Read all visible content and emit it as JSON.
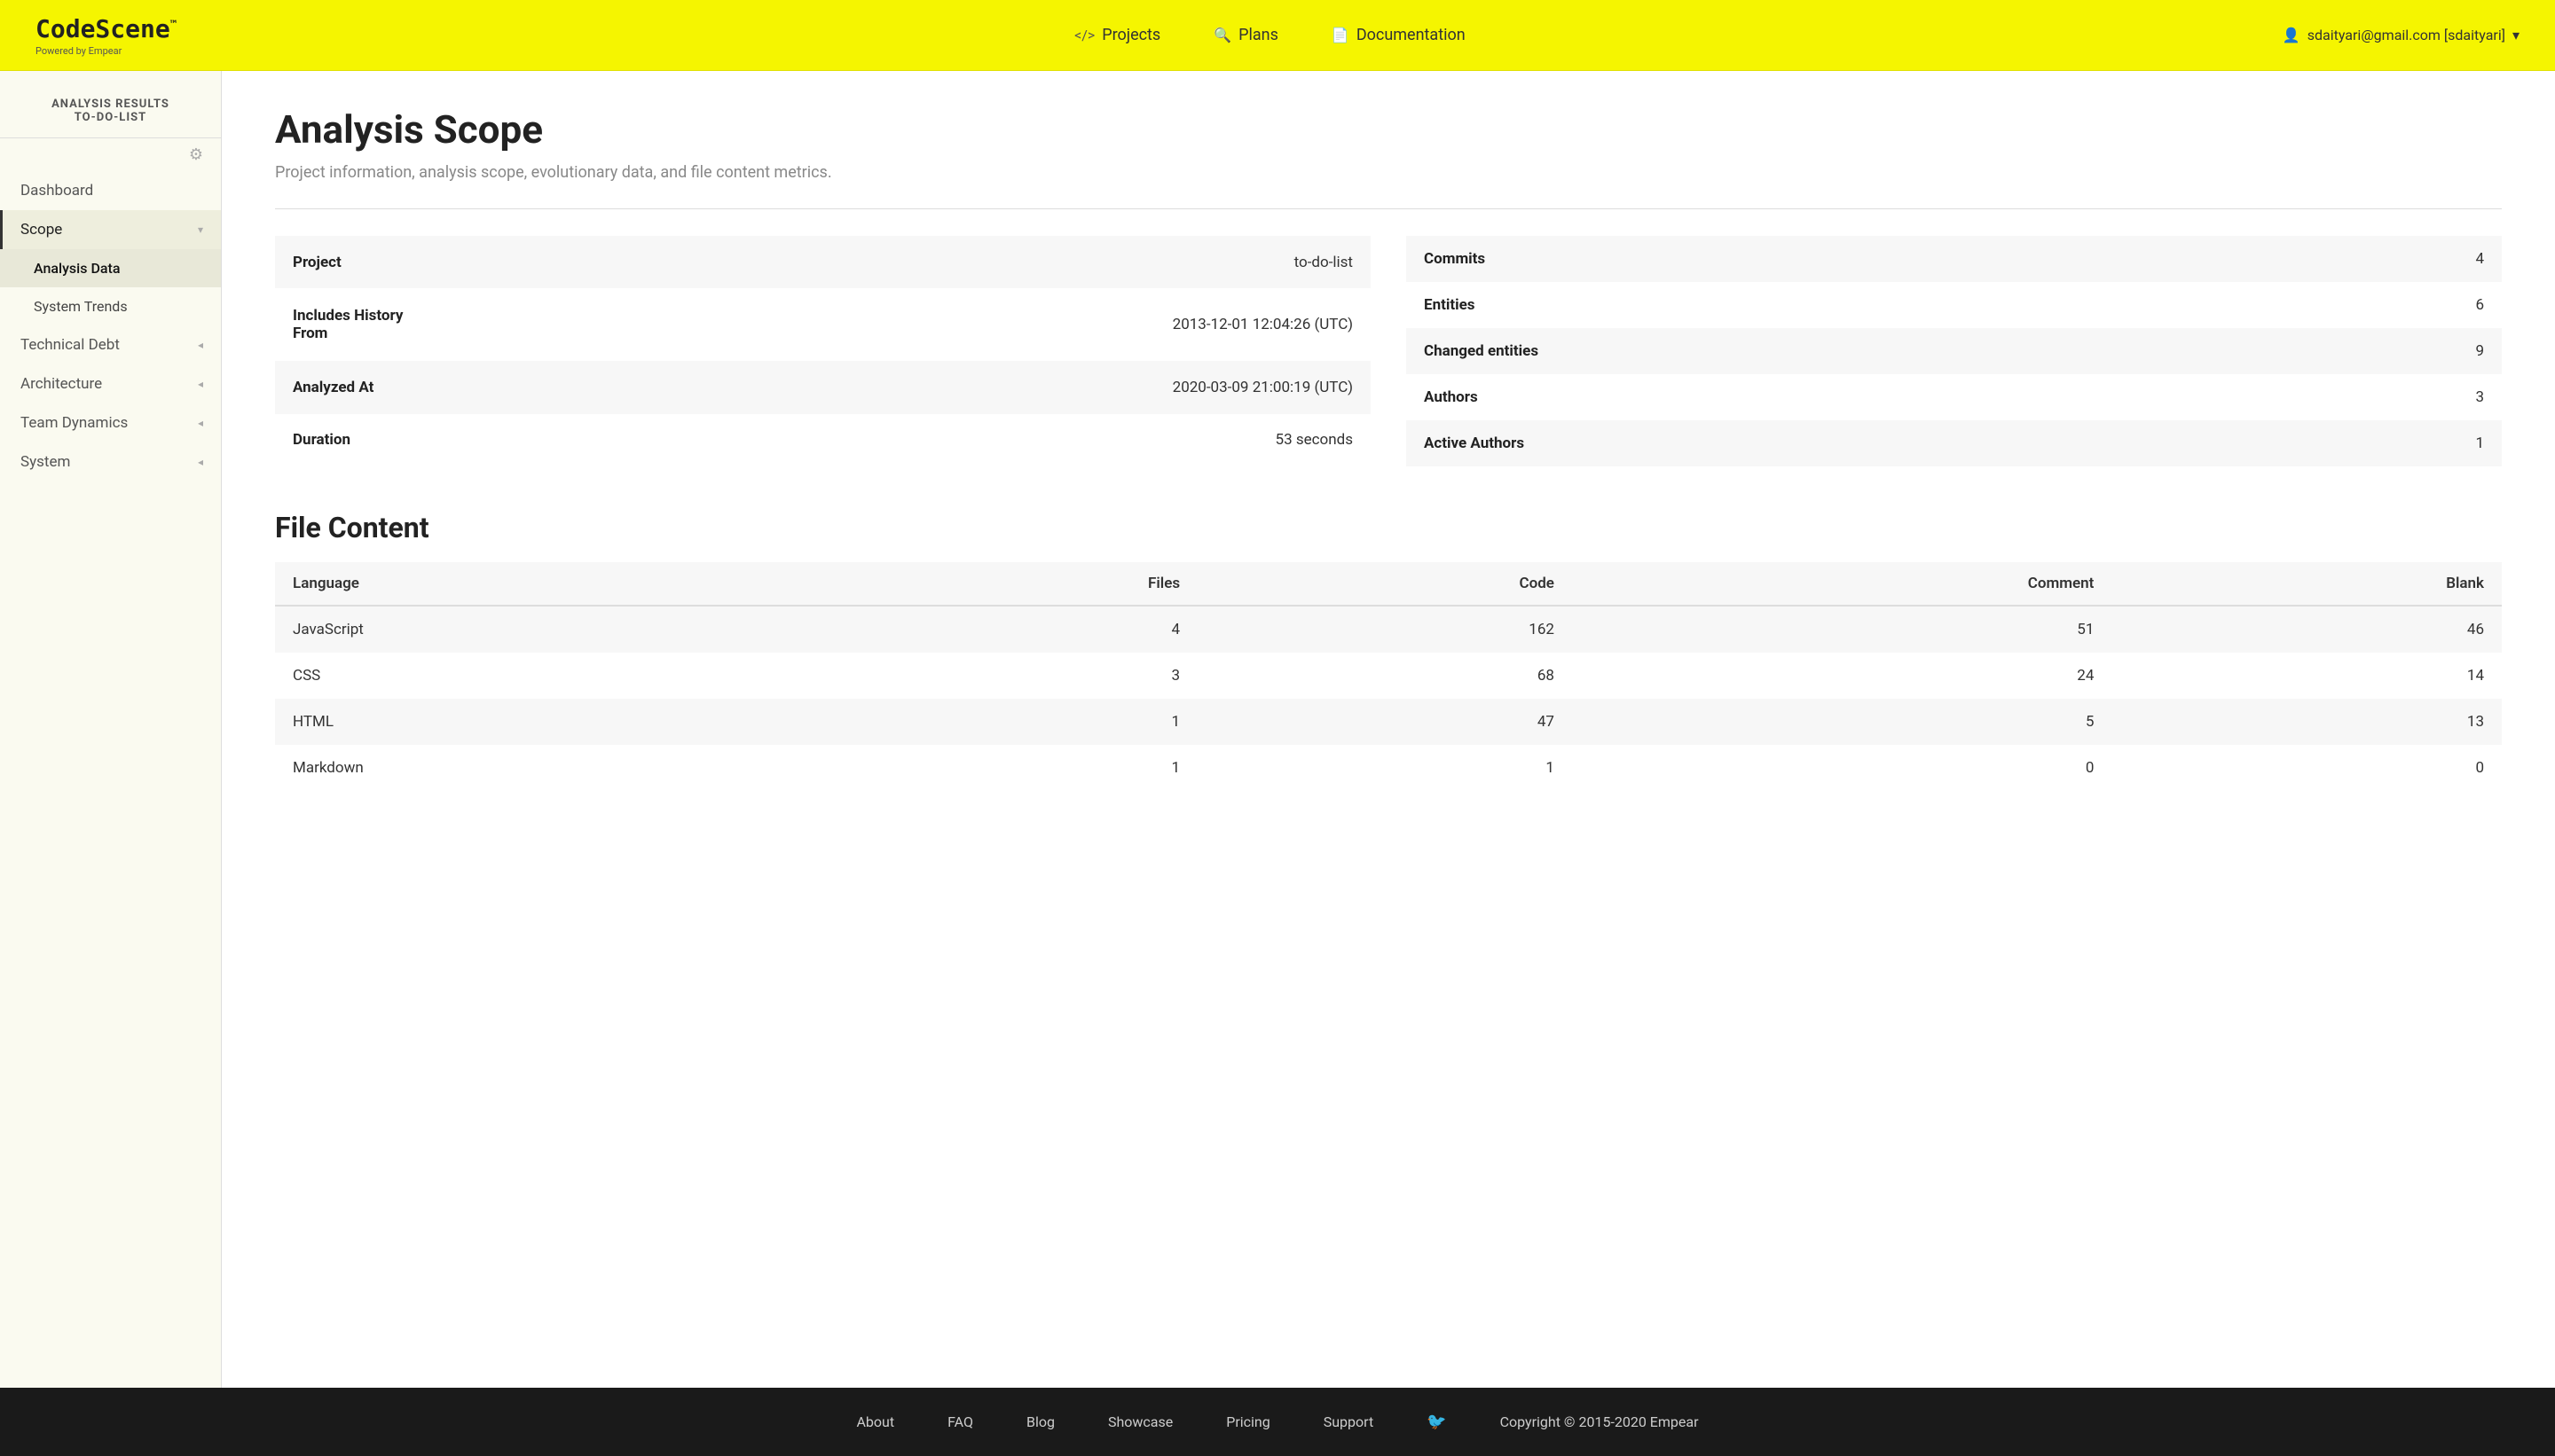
{
  "header": {
    "logo_title": "CodeScene",
    "logo_tm": "™",
    "logo_sub": "Powered by Empear",
    "nav": [
      {
        "label": "Projects",
        "icon": "</>"
      },
      {
        "label": "Plans",
        "icon": "🔍"
      },
      {
        "label": "Documentation",
        "icon": "📄"
      }
    ],
    "user": "sdaityari@gmail.com [sdaityari]",
    "user_icon": "👤"
  },
  "sidebar": {
    "title": "ANALYSIS RESULTS",
    "subtitle": "TO-DO-LIST",
    "items": [
      {
        "label": "Dashboard",
        "has_chevron": false,
        "active": false
      },
      {
        "label": "Scope",
        "has_chevron": true,
        "active": true
      },
      {
        "label": "Analysis Data",
        "is_sub": true,
        "active_sub": true
      },
      {
        "label": "System Trends",
        "is_sub": true,
        "active_sub": false
      },
      {
        "label": "Technical Debt",
        "has_chevron": true,
        "active": false
      },
      {
        "label": "Architecture",
        "has_chevron": true,
        "active": false
      },
      {
        "label": "Team Dynamics",
        "has_chevron": true,
        "active": false
      },
      {
        "label": "System",
        "has_chevron": true,
        "active": false
      }
    ]
  },
  "main": {
    "title": "Analysis Scope",
    "subtitle": "Project information, analysis scope, evolutionary data, and file content metrics.",
    "project_info": [
      {
        "label": "Project",
        "value": "to-do-list"
      },
      {
        "label": "Includes History From",
        "value": "2013-12-01 12:04:26 (UTC)"
      },
      {
        "label": "Analyzed At",
        "value": "2020-03-09 21:00:19 (UTC)"
      },
      {
        "label": "Duration",
        "value": "53 seconds"
      }
    ],
    "stats": [
      {
        "label": "Commits",
        "value": "4"
      },
      {
        "label": "Entities",
        "value": "6"
      },
      {
        "label": "Changed entities",
        "value": "9"
      },
      {
        "label": "Authors",
        "value": "3"
      },
      {
        "label": "Active Authors",
        "value": "1"
      }
    ],
    "file_content_title": "File Content",
    "file_table_headers": [
      "Language",
      "Files",
      "Code",
      "Comment",
      "Blank"
    ],
    "file_rows": [
      {
        "language": "JavaScript",
        "files": "4",
        "code": "162",
        "comment": "51",
        "blank": "46"
      },
      {
        "language": "CSS",
        "files": "3",
        "code": "68",
        "comment": "24",
        "blank": "14"
      },
      {
        "language": "HTML",
        "files": "1",
        "code": "47",
        "comment": "5",
        "blank": "13"
      },
      {
        "language": "Markdown",
        "files": "1",
        "code": "1",
        "comment": "0",
        "blank": "0"
      }
    ]
  },
  "footer": {
    "links": [
      "About",
      "FAQ",
      "Blog",
      "Showcase",
      "Pricing",
      "Support"
    ],
    "copyright": "Copyright © 2015-2020 Empear"
  }
}
